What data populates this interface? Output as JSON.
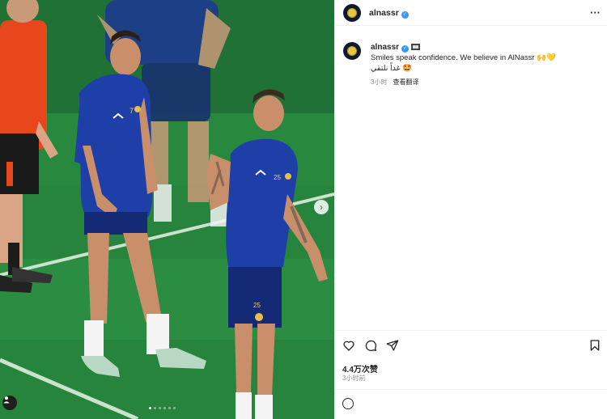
{
  "post": {
    "username": "alnassr",
    "caption_username": "alnassr",
    "caption_text": "Smiles speak confidence. We believe in AlNassr 🙌💛",
    "caption_arabic": "غداً نلتقي 🤩",
    "caption_time": "3小时",
    "see_translation": "查看翻译",
    "likes": "4.4万次赞",
    "post_time": "3小时前",
    "comment_placeholder": "",
    "post_label": ""
  },
  "media": {
    "carousel_count": 6,
    "active_index": 0,
    "jersey_numbers": [
      "7",
      "25"
    ]
  },
  "icons": [
    "verified-icon",
    "more-icon",
    "heart-icon",
    "comment-icon",
    "share-icon",
    "bookmark-icon",
    "next-arrow-icon",
    "user-tag-icon",
    "emoji-icon"
  ],
  "colors": {
    "pitch": "#2b8a40",
    "jersey": "#1f3fa8",
    "verified": "#3897f0",
    "muted": "#8e8e8e"
  }
}
